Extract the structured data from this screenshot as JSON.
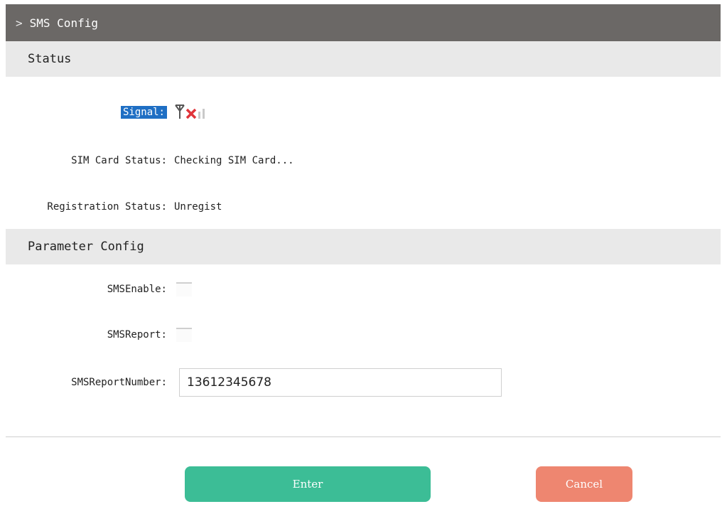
{
  "title_bar": {
    "chevron": ">",
    "title": "SMS Config"
  },
  "status_section": {
    "header": "Status",
    "signal_label": "Signal:",
    "signal_icon": "antenna-no-signal-icon",
    "sim_label": "SIM Card Status:",
    "sim_value": "Checking SIM Card...",
    "registration_label": "Registration Status:",
    "registration_value": "Unregist"
  },
  "parameter_section": {
    "header": "Parameter Config",
    "sms_enable_label": "SMSEnable:",
    "sms_enable_checked": false,
    "sms_report_label": "SMSReport:",
    "sms_report_checked": false,
    "sms_report_number_label": "SMSReportNumber:",
    "sms_report_number_value": "13612345678"
  },
  "buttons": {
    "enter_label": "Enter",
    "cancel_label": "Cancel"
  },
  "colors": {
    "title_bar_bg": "#6b6866",
    "section_bg": "#e9e9e9",
    "signal_highlight": "#1f6fc4",
    "enter_button": "#3cbd96",
    "cancel_button": "#ee8670",
    "no_signal_x": "#e0343a"
  }
}
